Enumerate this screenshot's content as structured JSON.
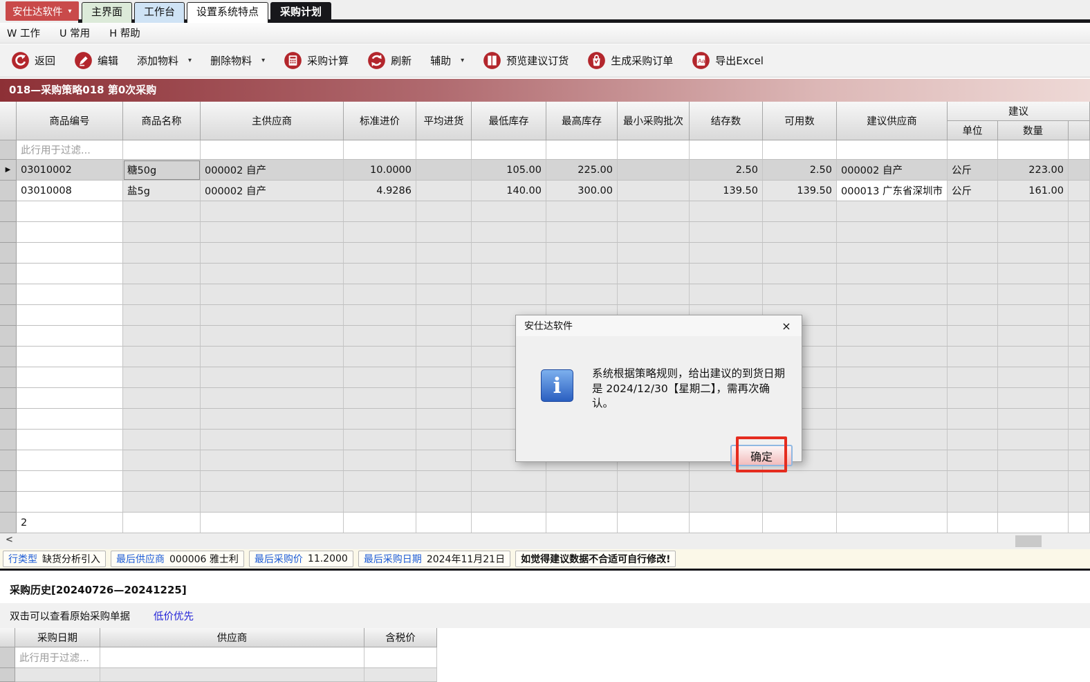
{
  "app": {
    "brand": "安仕达软件",
    "tabs": [
      {
        "label": "主界面"
      },
      {
        "label": "工作台"
      },
      {
        "label": "设置系统特点"
      },
      {
        "label": "采购计划"
      }
    ],
    "menu": [
      "W 工作",
      "U 常用",
      "H 帮助"
    ]
  },
  "toolbar": {
    "items": [
      {
        "label": "返回",
        "icon": "back-icon"
      },
      {
        "label": "编辑",
        "icon": "edit-icon"
      },
      {
        "label": "添加物料",
        "dropdown": "▾"
      },
      {
        "label": "删除物料",
        "dropdown": "▾"
      },
      {
        "label": "采购计算",
        "icon": "calculator-icon"
      },
      {
        "label": "刷新",
        "icon": "refresh-icon"
      },
      {
        "label": "辅助",
        "dropdown": "▾"
      },
      {
        "label": "预览建议订货",
        "icon": "preview-icon"
      },
      {
        "label": "生成采购订单",
        "icon": "order-icon"
      },
      {
        "label": "导出Excel",
        "icon": "excel-icon"
      }
    ]
  },
  "plan": {
    "title": "018—采购策略018 第0次采购"
  },
  "grid": {
    "columns": [
      "商品编号",
      "商品名称",
      "主供应商",
      "标准进价",
      "平均进货",
      "最低库存",
      "最高库存",
      "最小采购批次",
      "结存数",
      "可用数",
      "建议供应商"
    ],
    "suggest_group": {
      "label": "建议",
      "unit_label": "单位",
      "qty_label": "数量"
    },
    "filter_hint": "此行用于过滤...",
    "rows": [
      {
        "selected": true,
        "cells": [
          "03010002",
          "糖50g",
          "000002 自产",
          "10.0000",
          "",
          "105.00",
          "225.00",
          "",
          "2.50",
          "2.50",
          "000002 自产",
          "公斤",
          "223.00"
        ]
      },
      {
        "selected": false,
        "cells": [
          "03010008",
          "盐5g",
          "000002 自产",
          "4.9286",
          "",
          "140.00",
          "300.00",
          "",
          "139.50",
          "139.50",
          "000013 广东省深圳市",
          "公斤",
          "161.00"
        ]
      }
    ],
    "row_count": "2"
  },
  "scrollbar": {
    "left_arrow": "<"
  },
  "status_bar": {
    "segments": [
      {
        "label": "行类型",
        "value": "缺货分析引入"
      },
      {
        "label": "最后供应商",
        "value": "000006 雅士利"
      },
      {
        "label": "最后采购价",
        "value": "11.2000"
      },
      {
        "label": "最后采购日期",
        "value": "2024年11月21日"
      },
      {
        "label": "",
        "value": "如觉得建议数据不合适可自行修改!"
      }
    ]
  },
  "history": {
    "title": "采购历史[20240726—20241225]",
    "hint": "双击可以查看原始采购单据",
    "link": "低价优先",
    "columns": [
      "采购日期",
      "供应商",
      "含税价"
    ],
    "filter_hint": "此行用于过滤..."
  },
  "dialog": {
    "title": "安仕达软件",
    "close": "×",
    "info_glyph": "i",
    "message": "系统根据策略规则，给出建议的到货日期是 2024/12/30【星期二】，需再次确认。",
    "ok_label": "确定"
  },
  "colors": {
    "accent_red": "#c94a4a",
    "icon_red": "#b3262c",
    "title_bar_left": "#8d3036",
    "title_bar_right": "#eed9d6",
    "active_tab": "#17171b",
    "tab_green": "#dcead9",
    "tab_blue": "#cfe3f5",
    "status_label_blue": "#1d5cd6",
    "link_blue": "#2323d8",
    "highlight_red": "#e52c1f",
    "info_icon_blue": "#2a5fc0",
    "selected_row": "#d4d4d4"
  }
}
